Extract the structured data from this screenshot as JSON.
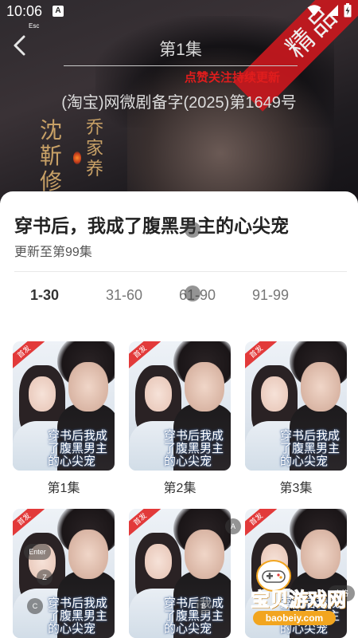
{
  "statusbar": {
    "time": "10:06",
    "a_badge": "A",
    "esc_label": "Esc",
    "icons": [
      "wifi-icon",
      "signal-icon",
      "battery-charging-icon"
    ]
  },
  "player": {
    "episode_title": "第1集",
    "ribbon_text": "精品",
    "follow_note": "点赞关注持续更新",
    "registration": "(淘宝)网微剧备字(2025)第1649号",
    "vertical_text_left": "沈靳修",
    "vertical_text_right": "乔家养"
  },
  "sheet": {
    "title": "穿书后，我成了腹黑男主的心尖宠",
    "update": "更新至第99集",
    "tabs": [
      {
        "label": "1-30",
        "active": true
      },
      {
        "label": "31-60",
        "active": false
      },
      {
        "label": "61-90",
        "active": false
      },
      {
        "label": "91-99",
        "active": false
      }
    ],
    "poster_badge": "首发",
    "poster_overlay": "穿书后我成了腹黑男主的心尖宠",
    "episodes": [
      {
        "label": "第1集"
      },
      {
        "label": "第2集"
      },
      {
        "label": "第3集"
      },
      {
        "label": ""
      },
      {
        "label": ""
      },
      {
        "label": ""
      }
    ]
  },
  "key_hints": {
    "enter": "Enter",
    "z": "Z",
    "c": "C",
    "b": "B",
    "a": "A",
    "space": "空格"
  },
  "watermark": {
    "text": "宝贝游戏网",
    "url": "baobeiy.com"
  },
  "colors": {
    "ribbon": "#c8181e",
    "follow_note": "#e01d1d",
    "gold_text": "#c7a066",
    "watermark": "#f2a51f"
  }
}
